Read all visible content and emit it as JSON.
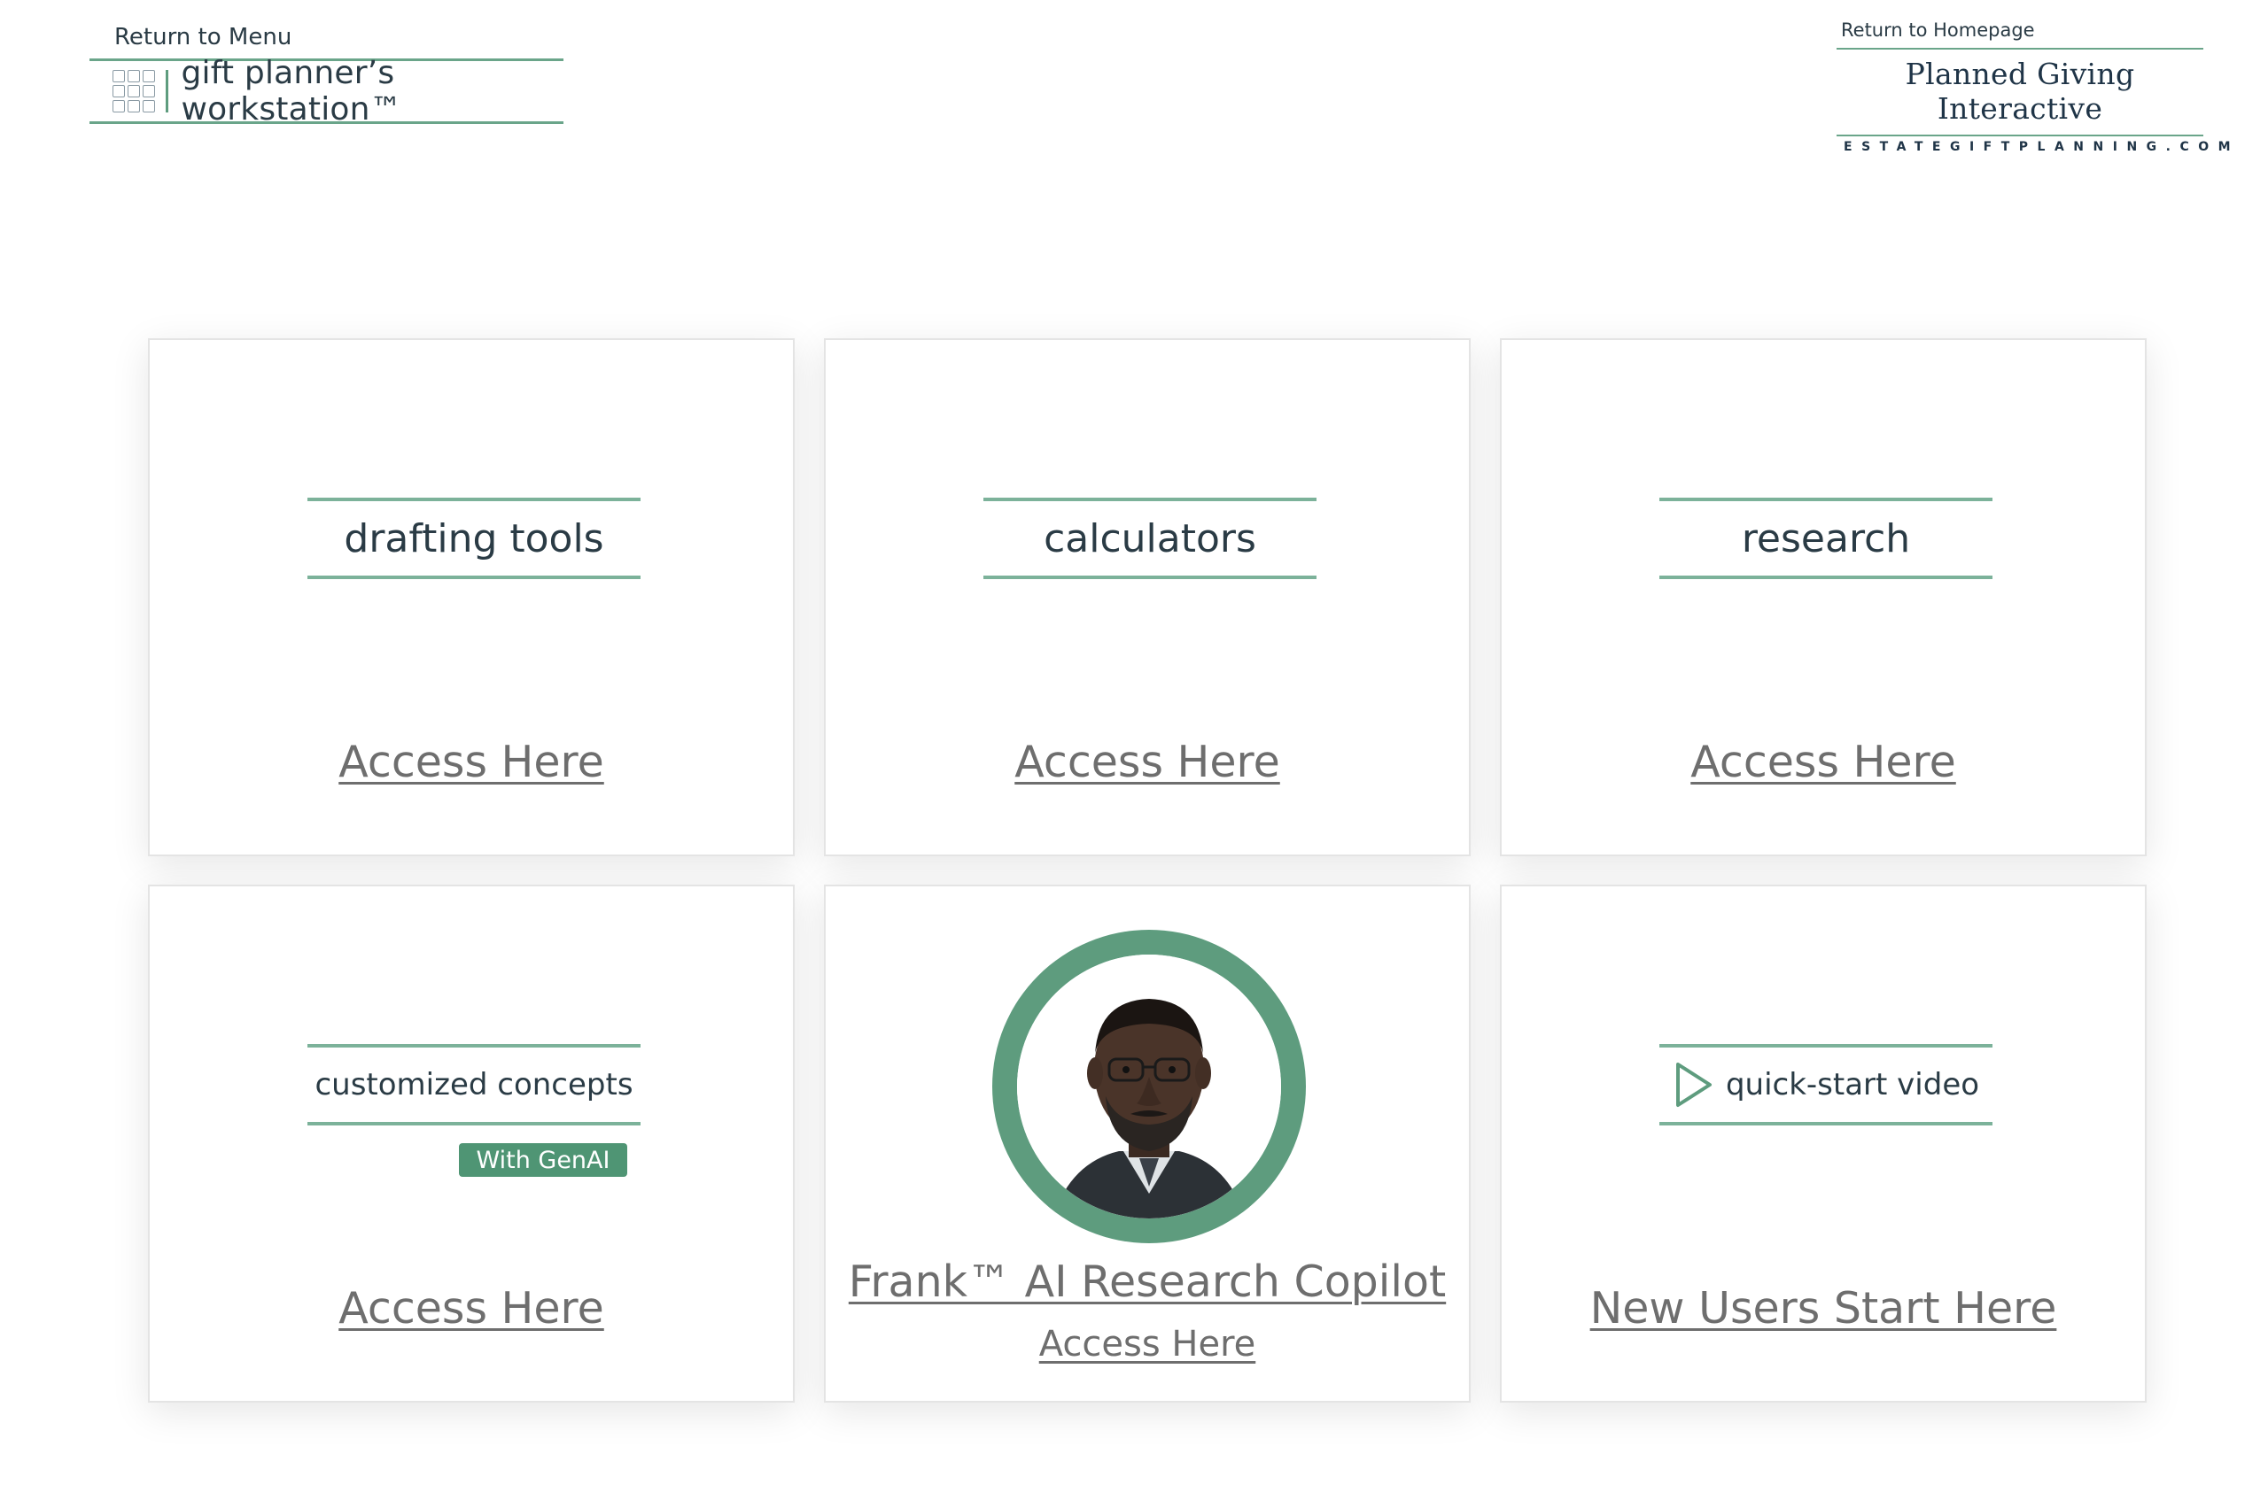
{
  "header": {
    "left": {
      "return_label": "Return to Menu",
      "brand_name": "gift planner’s workstation™",
      "logo_icon": "grid-logo-icon"
    },
    "right": {
      "return_label": "Return to Homepage",
      "brand_name": "Planned Giving Interactive",
      "domain": "ESTATEGIFTPLANNING.COM"
    }
  },
  "colors": {
    "accent_green": "#5e9c7e",
    "rule_green": "#7cb29a",
    "badge_green": "#4f9574",
    "link_gray": "#6e6e6e",
    "text_dark": "#2a3b45"
  },
  "cards": [
    {
      "title": "drafting tools",
      "link": "Access Here"
    },
    {
      "title": "calculators",
      "link": "Access Here"
    },
    {
      "title": "research",
      "link": "Access Here"
    },
    {
      "title": "customized concepts",
      "badge": "With GenAI",
      "link": "Access Here"
    },
    {
      "title": "Frank™ AI Research Copilot",
      "link": "Access Here",
      "avatar": "frank-avatar-portrait"
    },
    {
      "title": "quick-start video",
      "icon": "play-icon",
      "link": "New Users Start Here"
    }
  ]
}
